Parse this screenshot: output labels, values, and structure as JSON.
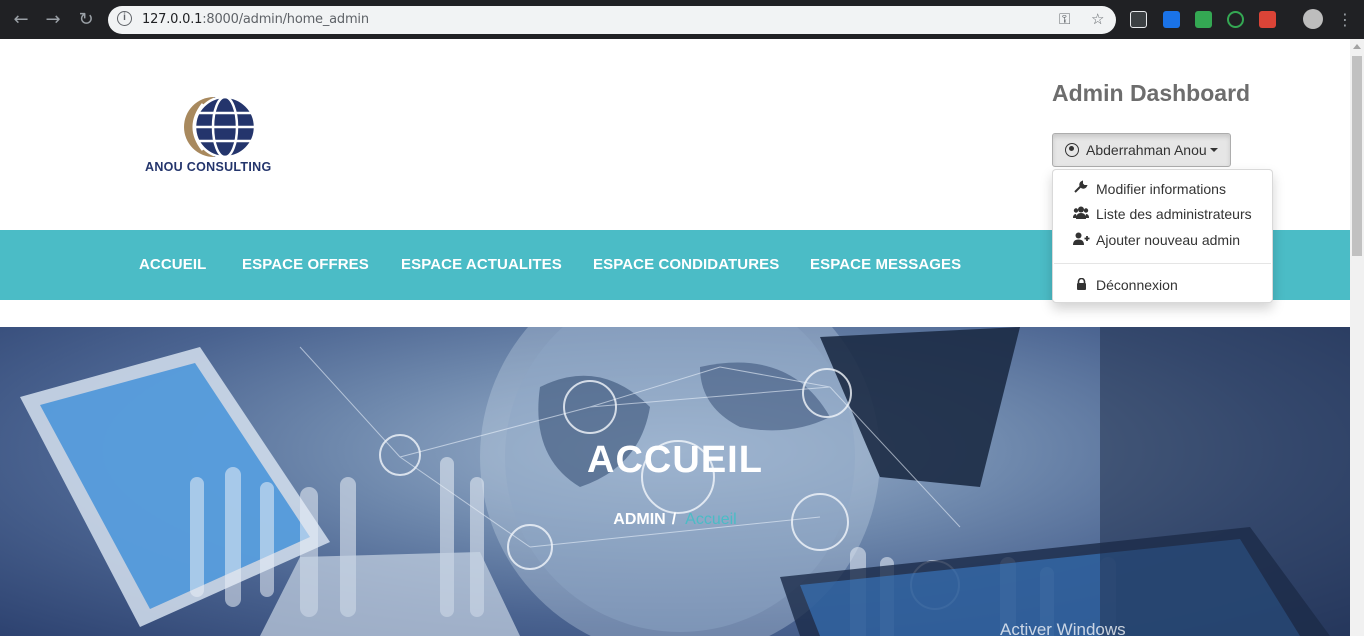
{
  "browser": {
    "url_host": "127.0.0.1",
    "url_path": ":8000/admin/home_admin"
  },
  "brand": {
    "logo_text": "ANOU CONSULTING"
  },
  "header": {
    "title": "Admin Dashboard",
    "user_name": "Abderrahman Anou"
  },
  "user_menu": {
    "items": [
      {
        "label": "Modifier informations",
        "icon": "wrench-icon"
      },
      {
        "label": "Liste des administrateurs",
        "icon": "users-icon"
      },
      {
        "label": "Ajouter nouveau admin",
        "icon": "user-plus-icon"
      },
      {
        "label": "Déconnexion",
        "icon": "lock-icon"
      }
    ]
  },
  "nav": {
    "items": [
      "ACCUEIL",
      "ESPACE OFFRES",
      "ESPACE ACTUALITES",
      "ESPACE CONDIDATURES",
      "ESPACE MESSAGES"
    ]
  },
  "hero": {
    "title": "ACCUEIL",
    "breadcrumb_root": "ADMIN",
    "breadcrumb_separator": "/",
    "breadcrumb_current": "Accueil"
  },
  "os": {
    "watermark": "Activer Windows"
  },
  "colors": {
    "accent": "#4bbcc6",
    "brand_navy": "#24356c",
    "brand_gold": "#a8895e"
  }
}
